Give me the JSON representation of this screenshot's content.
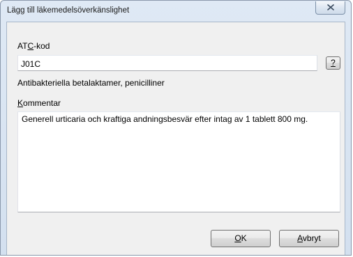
{
  "window": {
    "title": "Lägg till läkemedelsöverkänslighet",
    "close_icon": "close-icon"
  },
  "atc": {
    "label_pre": "AT",
    "label_mnemonic": "C",
    "label_post": "-kod",
    "value": "J01C",
    "help_label": "?",
    "description": "Antibakteriella betalaktamer, penicilliner"
  },
  "comment": {
    "label_mnemonic": "K",
    "label_rest": "ommentar",
    "value": "Generell urticaria och kraftiga andningsbesvär efter intag av 1 tablett 800 mg."
  },
  "buttons": {
    "ok_mnemonic": "O",
    "ok_rest": "K",
    "cancel_mnemonic": "A",
    "cancel_rest": "vbryt"
  }
}
